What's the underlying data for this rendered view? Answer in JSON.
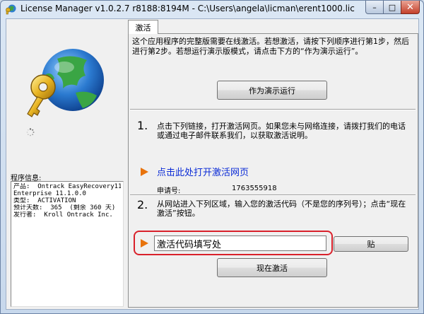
{
  "window": {
    "title": "License Manager v1.0.2.7 r8188:8194M - C:\\Users\\angela\\licman\\erent1000.lic",
    "min_glyph": "–",
    "max_glyph": "□",
    "close_glyph": "✕"
  },
  "left": {
    "info_label": "程序信息:",
    "info_lines": [
      "产品:  Ontrack EasyRecovery11",
      "Enterprise 11.1.0.0",
      "类型:  ACTIVATION",
      "预计天数:  365  (剩余 360 天)",
      "发行者:  Kroll Ontrack Inc."
    ]
  },
  "tab": {
    "label": "激活"
  },
  "panel": {
    "intro": "这个应用程序的完整版需要在线激活。若想激活，请按下列顺序进行第1步，然后进行第2步。若想运行演示版模式，请点击下方的“作为演示运行”。",
    "demo_button": "作为演示运行",
    "step1_number": "1.",
    "step1_text": "点击下列链接，打开激活网页。如果您未与网络连接，请拨打我们的电话或通过电子邮件联系我们，以获取激活说明。",
    "link_text": "点击此处打开激活网页",
    "request_label": "申请号:",
    "request_value": "1763555918",
    "step2_number": "2.",
    "step2_text": "从网站进入下列区域，输入您的激活代码（不是您的序列号）；点击“现在激活”按钮。",
    "code_value": "激活代码填写处",
    "paste_button": "贴",
    "activate_button": "现在激活"
  },
  "colors": {
    "arrow": "#e8730c",
    "link": "#0b2bd6",
    "highlight": "#d9212b",
    "close_button": "#c4402b"
  },
  "icons": {
    "app": "key-globe-icon",
    "logo": "key-globe-logo",
    "spinner": "loading-spinner-icon"
  }
}
